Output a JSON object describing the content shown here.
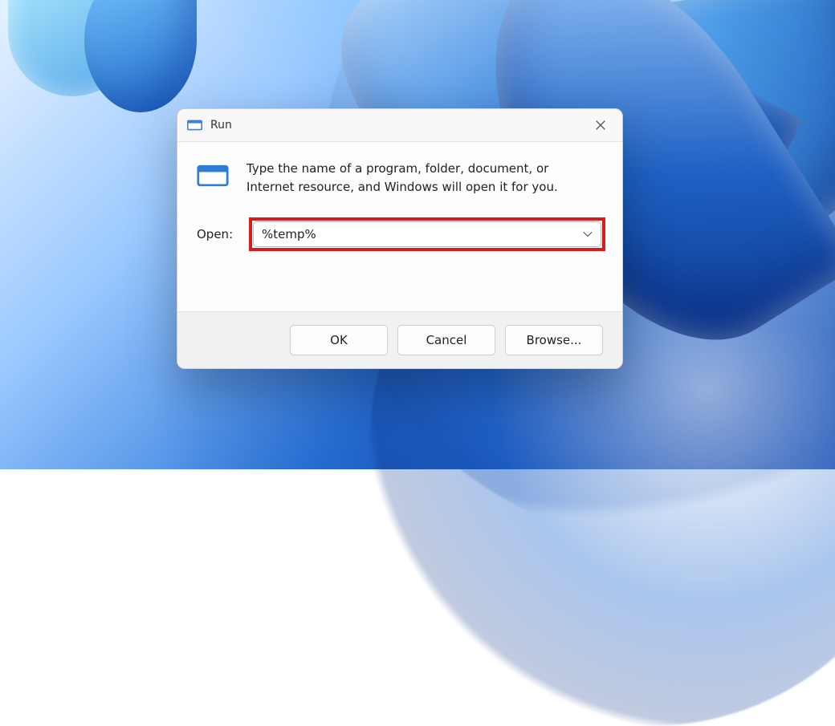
{
  "dialog": {
    "title": "Run",
    "description": "Type the name of a program, folder, document, or Internet resource, and Windows will open it for you.",
    "open_label": "Open:",
    "input_value": "%temp%",
    "buttons": {
      "ok": "OK",
      "cancel": "Cancel",
      "browse": "Browse..."
    }
  },
  "annotation": {
    "highlight_target": "open-combobox",
    "highlight_color": "#d61c1c"
  }
}
